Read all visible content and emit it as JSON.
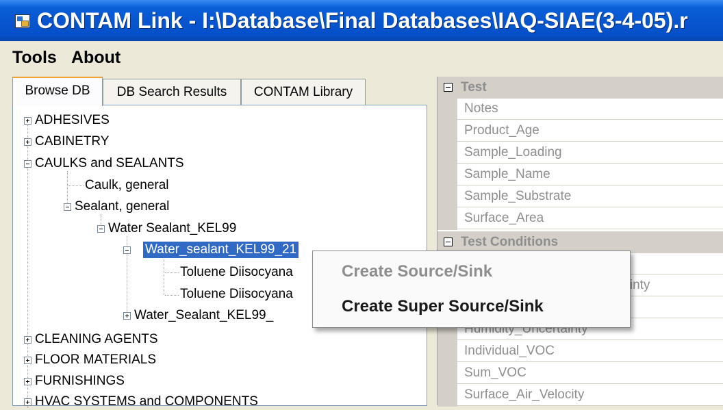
{
  "window": {
    "title": "CONTAM Link - I:\\Database\\Final Databases\\IAQ-SIAE(3-4-05).r"
  },
  "menu": {
    "tools": "Tools",
    "about": "About"
  },
  "tabs": [
    "Browse DB",
    "DB Search Results",
    "CONTAM Library"
  ],
  "tree": {
    "adhesives": "ADHESIVES",
    "cabinetry": "CABINETRY",
    "caulks": "CAULKS and SEALANTS",
    "caulk_general": "Caulk, general",
    "sealant_general": "Sealant, general",
    "water_sealant": "Water Sealant_KEL99",
    "water_sealant_21": "Water_sealant_KEL99_21",
    "toluene_1": "Toluene Diisocyana",
    "toluene_2": "Toluene Diisocyana",
    "water_sealant_b": "Water_Sealant_KEL99_",
    "cleaning": "CLEANING AGENTS",
    "floor": "FLOOR MATERIALS",
    "furnishings": "FURNISHINGS",
    "hvac": "HVAC SYSTEMS and COMPONENTS"
  },
  "properties": {
    "test_category": "Test",
    "test_items": [
      "Notes",
      "Product_Age",
      "Sample_Loading",
      "Sample_Name",
      "Sample_Substrate",
      "Surface_Area"
    ],
    "conditions_category": "Test Conditions",
    "conditions_items": [
      "",
      "tainty",
      "",
      "Humidity_Uncertainty",
      "Individual_VOC",
      "Sum_VOC",
      "Surface_Air_Velocity"
    ]
  },
  "context_menu": {
    "create_source_sink": "Create Source/Sink",
    "create_super_source_sink": "Create Super Source/Sink"
  }
}
